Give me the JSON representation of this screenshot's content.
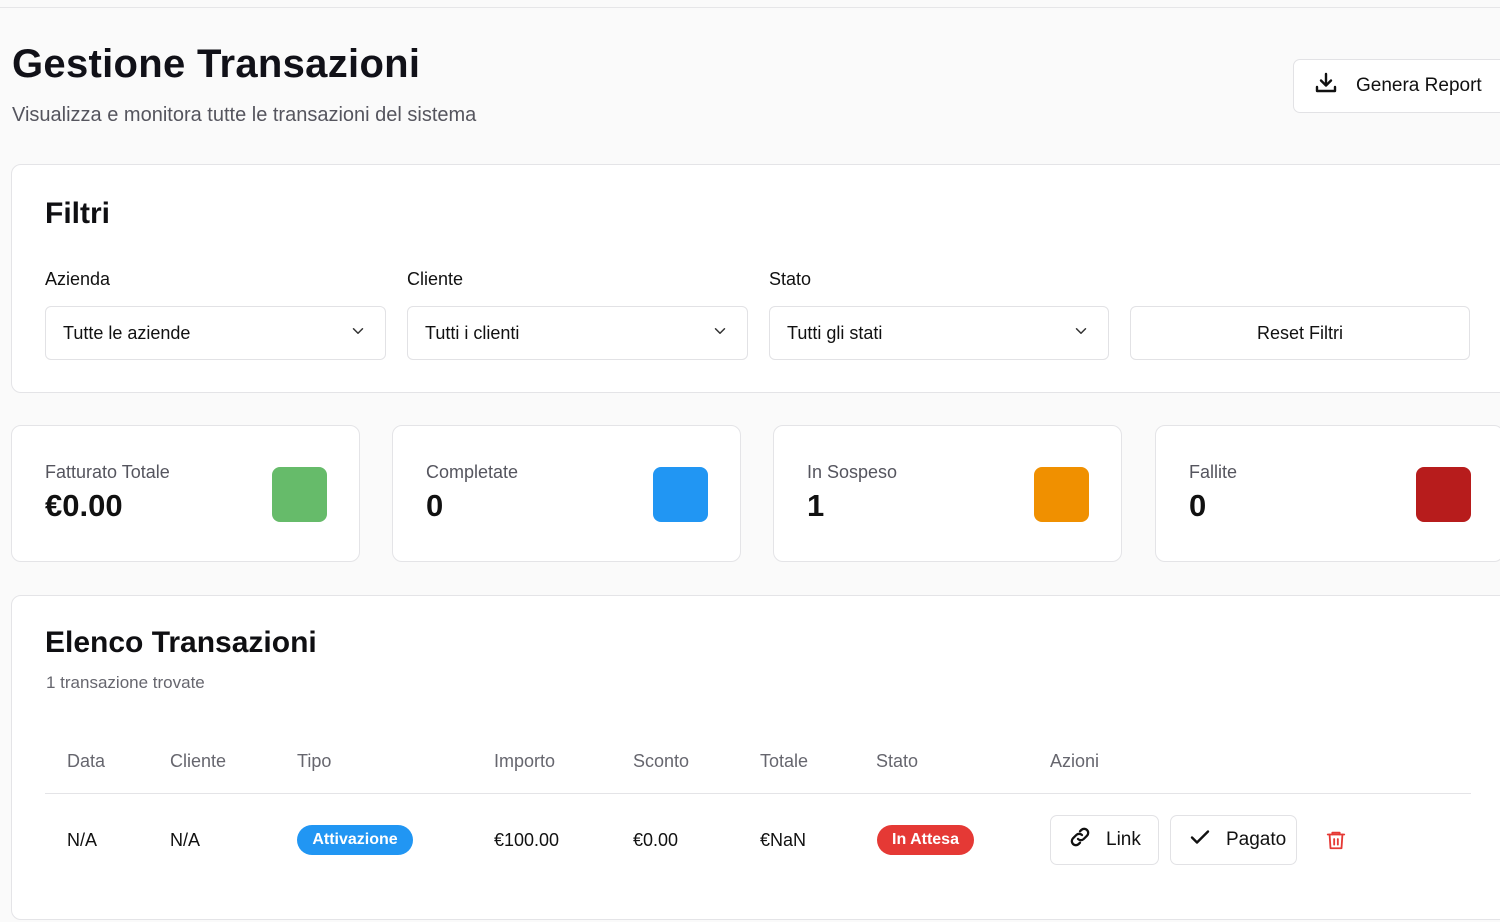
{
  "header": {
    "title": "Gestione Transazioni",
    "subtitle": "Visualizza e monitora tutte le transazioni del sistema",
    "report_button": "Genera Report"
  },
  "filters": {
    "title": "Filtri",
    "company": {
      "label": "Azienda",
      "value": "Tutte le aziende"
    },
    "client": {
      "label": "Cliente",
      "value": "Tutti i clienti"
    },
    "status": {
      "label": "Stato",
      "value": "Tutti gli stati"
    },
    "reset_button": "Reset Filtri"
  },
  "stats": [
    {
      "label": "Fatturato Totale",
      "value": "€0.00",
      "color": "#66bb6a"
    },
    {
      "label": "Completate",
      "value": "0",
      "color": "#2196f3"
    },
    {
      "label": "In Sospeso",
      "value": "1",
      "color": "#f09000"
    },
    {
      "label": "Fallite",
      "value": "0",
      "color": "#b71c1c"
    }
  ],
  "transactions": {
    "title": "Elenco Transazioni",
    "count_text": "1 transazione trovate",
    "columns": [
      "Data",
      "Cliente",
      "Tipo",
      "Importo",
      "Sconto",
      "Totale",
      "Stato",
      "Azioni"
    ],
    "rows": [
      {
        "data": "N/A",
        "cliente": "N/A",
        "tipo": "Attivazione",
        "importo": "€100.00",
        "sconto": "€0.00",
        "totale": "€NaN",
        "stato": "In Attesa",
        "link_label": "Link",
        "paid_label": "Pagato"
      }
    ]
  },
  "colors": {
    "type_badge": "#2196f3",
    "status_pending_badge": "#e53935",
    "delete_icon": "#e53935"
  }
}
